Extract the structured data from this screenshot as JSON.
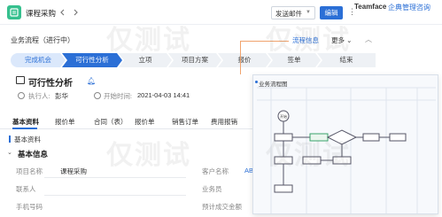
{
  "header": {
    "title": "课程采购",
    "send_mail": "发送邮件",
    "edit": "编辑",
    "brand": "Teamface",
    "brand_sub": "企典管理咨询"
  },
  "process": {
    "label": "业务流程（进行中）",
    "info_link": "流程信息",
    "more": "更多"
  },
  "steps": [
    "完成机会",
    "可行性分析",
    "立项",
    "项目方案",
    "报价",
    "签单",
    "结束"
  ],
  "record": {
    "title": "可行性分析",
    "owner_label": "执行人:",
    "owner": "彭华",
    "start_label": "开始时间:",
    "start": "2021-04-03 14:41"
  },
  "tabs": [
    "基本资料",
    "报价单",
    "合同（表）",
    "报价单",
    "销售订单",
    "费用报销"
  ],
  "sections": {
    "basic": "基本资料",
    "basic_info": "基本信息"
  },
  "fields": [
    {
      "k": "项目名称",
      "v": "课程采购",
      "k2": "客户名称",
      "v2": "ABC"
    },
    {
      "k": "联系人",
      "v": "",
      "k2": "业务员",
      "v2": ""
    },
    {
      "k": "手机号码",
      "v": "",
      "k2": "预计成交金额",
      "v2": ""
    }
  ],
  "popup": {
    "title": "业务流程图",
    "node_start": "开始"
  },
  "watermark": [
    "仅测试",
    "仅测试",
    "仅测试",
    "仅测试"
  ]
}
